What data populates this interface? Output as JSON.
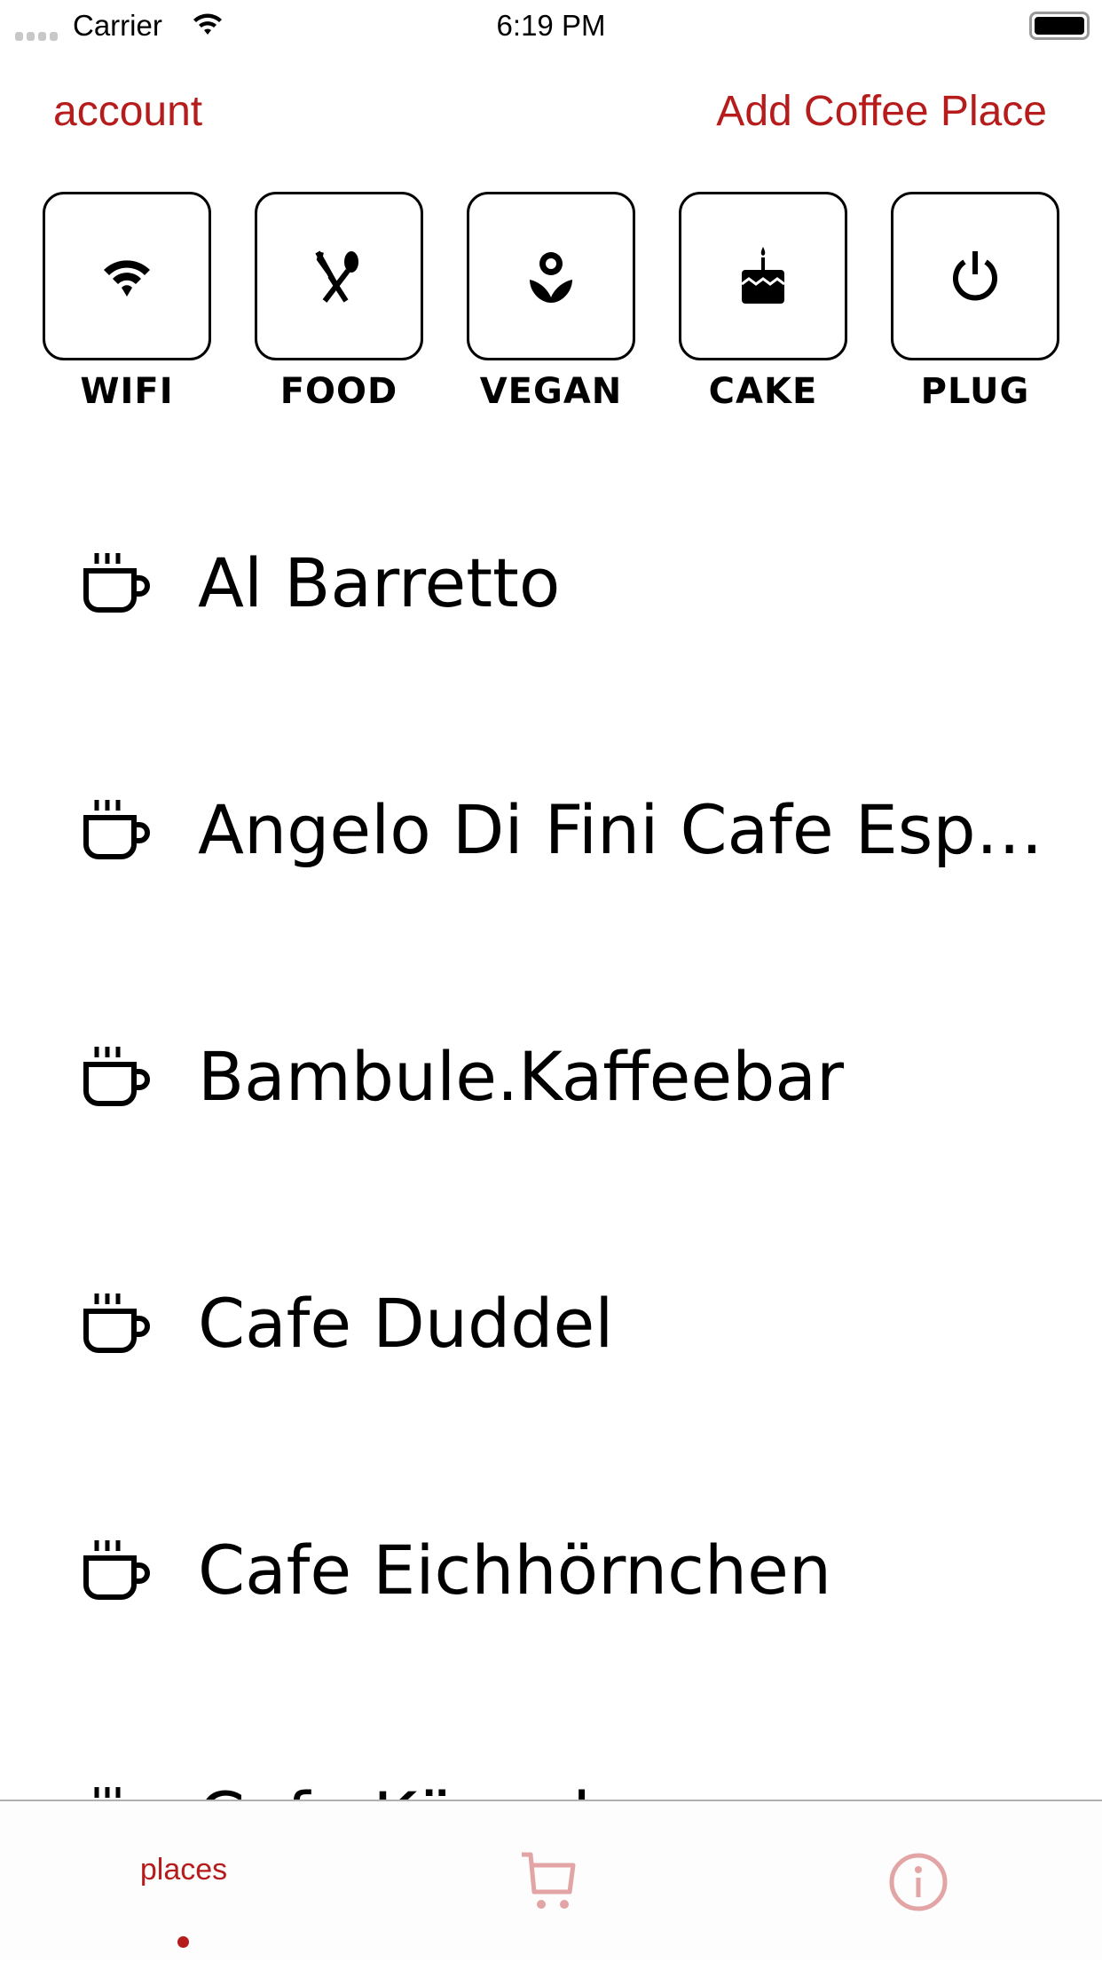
{
  "status_bar": {
    "carrier": "Carrier",
    "time": "6:19 PM"
  },
  "nav": {
    "left_button": "account",
    "right_button": "Add Coffee Place"
  },
  "colors": {
    "accent": "#b71c1c",
    "inactive_tab": "#e2a4a4"
  },
  "filters": [
    {
      "label": "WIFI",
      "icon": "wifi-icon"
    },
    {
      "label": "FOOD",
      "icon": "fork-spoon-icon"
    },
    {
      "label": "VEGAN",
      "icon": "flower-icon"
    },
    {
      "label": "CAKE",
      "icon": "cake-icon"
    },
    {
      "label": "PLUG",
      "icon": "power-icon"
    }
  ],
  "places": [
    {
      "name": "Al Barretto"
    },
    {
      "name": "Angelo Di Fini Cafe Espresso"
    },
    {
      "name": "Bambule.Kaffeebar"
    },
    {
      "name": "Cafe Duddel"
    },
    {
      "name": "Cafe Eichhörnchen"
    },
    {
      "name": "Cafe Käuzchen"
    }
  ],
  "tabbar": {
    "places_label": "places",
    "cart_icon": "cart-icon",
    "info_icon": "info-icon"
  }
}
